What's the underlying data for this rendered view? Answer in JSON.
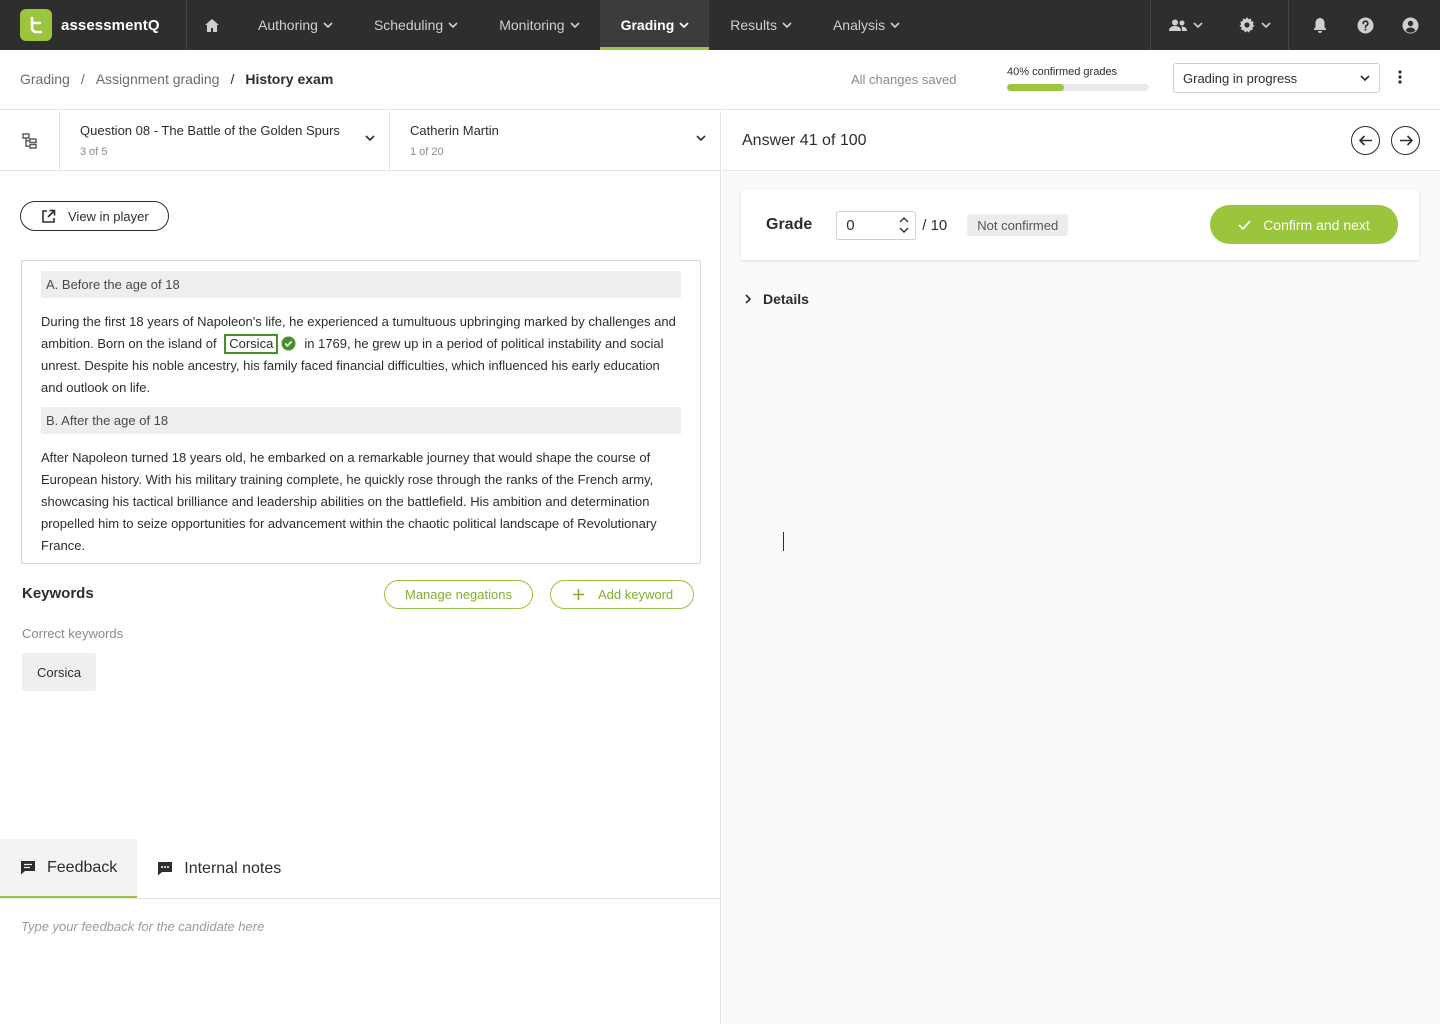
{
  "app": {
    "name": "assessmentQ"
  },
  "nav": {
    "items": [
      {
        "label": "Authoring"
      },
      {
        "label": "Scheduling"
      },
      {
        "label": "Monitoring"
      },
      {
        "label": "Grading",
        "active": true
      },
      {
        "label": "Results"
      },
      {
        "label": "Analysis"
      }
    ],
    "icons": [
      "home-icon",
      "users-icon",
      "gear-icon",
      "bell-icon",
      "help-icon",
      "user-icon"
    ]
  },
  "breadcrumb": [
    "Grading",
    "Assignment grading",
    "History exam"
  ],
  "header": {
    "save_status": "All changes saved",
    "progress_label": "40% confirmed grades",
    "progress_value": 0.4,
    "status_select": "Grading in progress"
  },
  "question_selector": {
    "title": "Question 08 - The Battle of the Golden Spurs",
    "sub": "3 of 5"
  },
  "candidate_selector": {
    "title": "Catherin Martin",
    "sub": "1 of 20"
  },
  "view_in_player": "View in player",
  "answer": {
    "section_a": {
      "heading": "A. Before the age of 18",
      "text_before": "During the first 18 years of Napoleon's life, he experienced a tumultuous upbringing marked by challenges and ambition. Born on the island of",
      "keyword": "Corsica",
      "text_after": "in 1769, he grew up in a period of political instability and social unrest. Despite his noble ancestry, his family faced financial difficulties, which influenced his early education and outlook on life."
    },
    "section_b": {
      "heading": "B. After the age of 18",
      "text": "After Napoleon turned 18 years old, he embarked on a remarkable journey that would shape the course of European history. With his military training complete, he quickly rose through the ranks of the French army, showcasing his tactical brilliance and leadership abilities on the battlefield. His ambition and determination propelled him to seize opportunities for advancement within the chaotic political landscape of Revolutionary France."
    }
  },
  "keywords": {
    "title": "Keywords",
    "manage_negations": "Manage negations",
    "add_keyword": "Add keyword",
    "correct_label": "Correct keywords",
    "correct": [
      "Corsica"
    ]
  },
  "tabs": [
    {
      "label": "Feedback",
      "active": true
    },
    {
      "label": "Internal notes"
    }
  ],
  "feedback_placeholder": "Type your feedback for the candidate here",
  "right": {
    "answer_title": "Answer 41 of 100",
    "grade_label": "Grade",
    "grade_value": "0",
    "grade_max": "/ 10",
    "status_badge": "Not confirmed",
    "confirm_label": "Confirm and next",
    "details_label": "Details"
  },
  "colors": {
    "accent": "#9bc53d",
    "nav_bg": "#2e2e2e",
    "keyword_ok": "#4a8f2f"
  }
}
